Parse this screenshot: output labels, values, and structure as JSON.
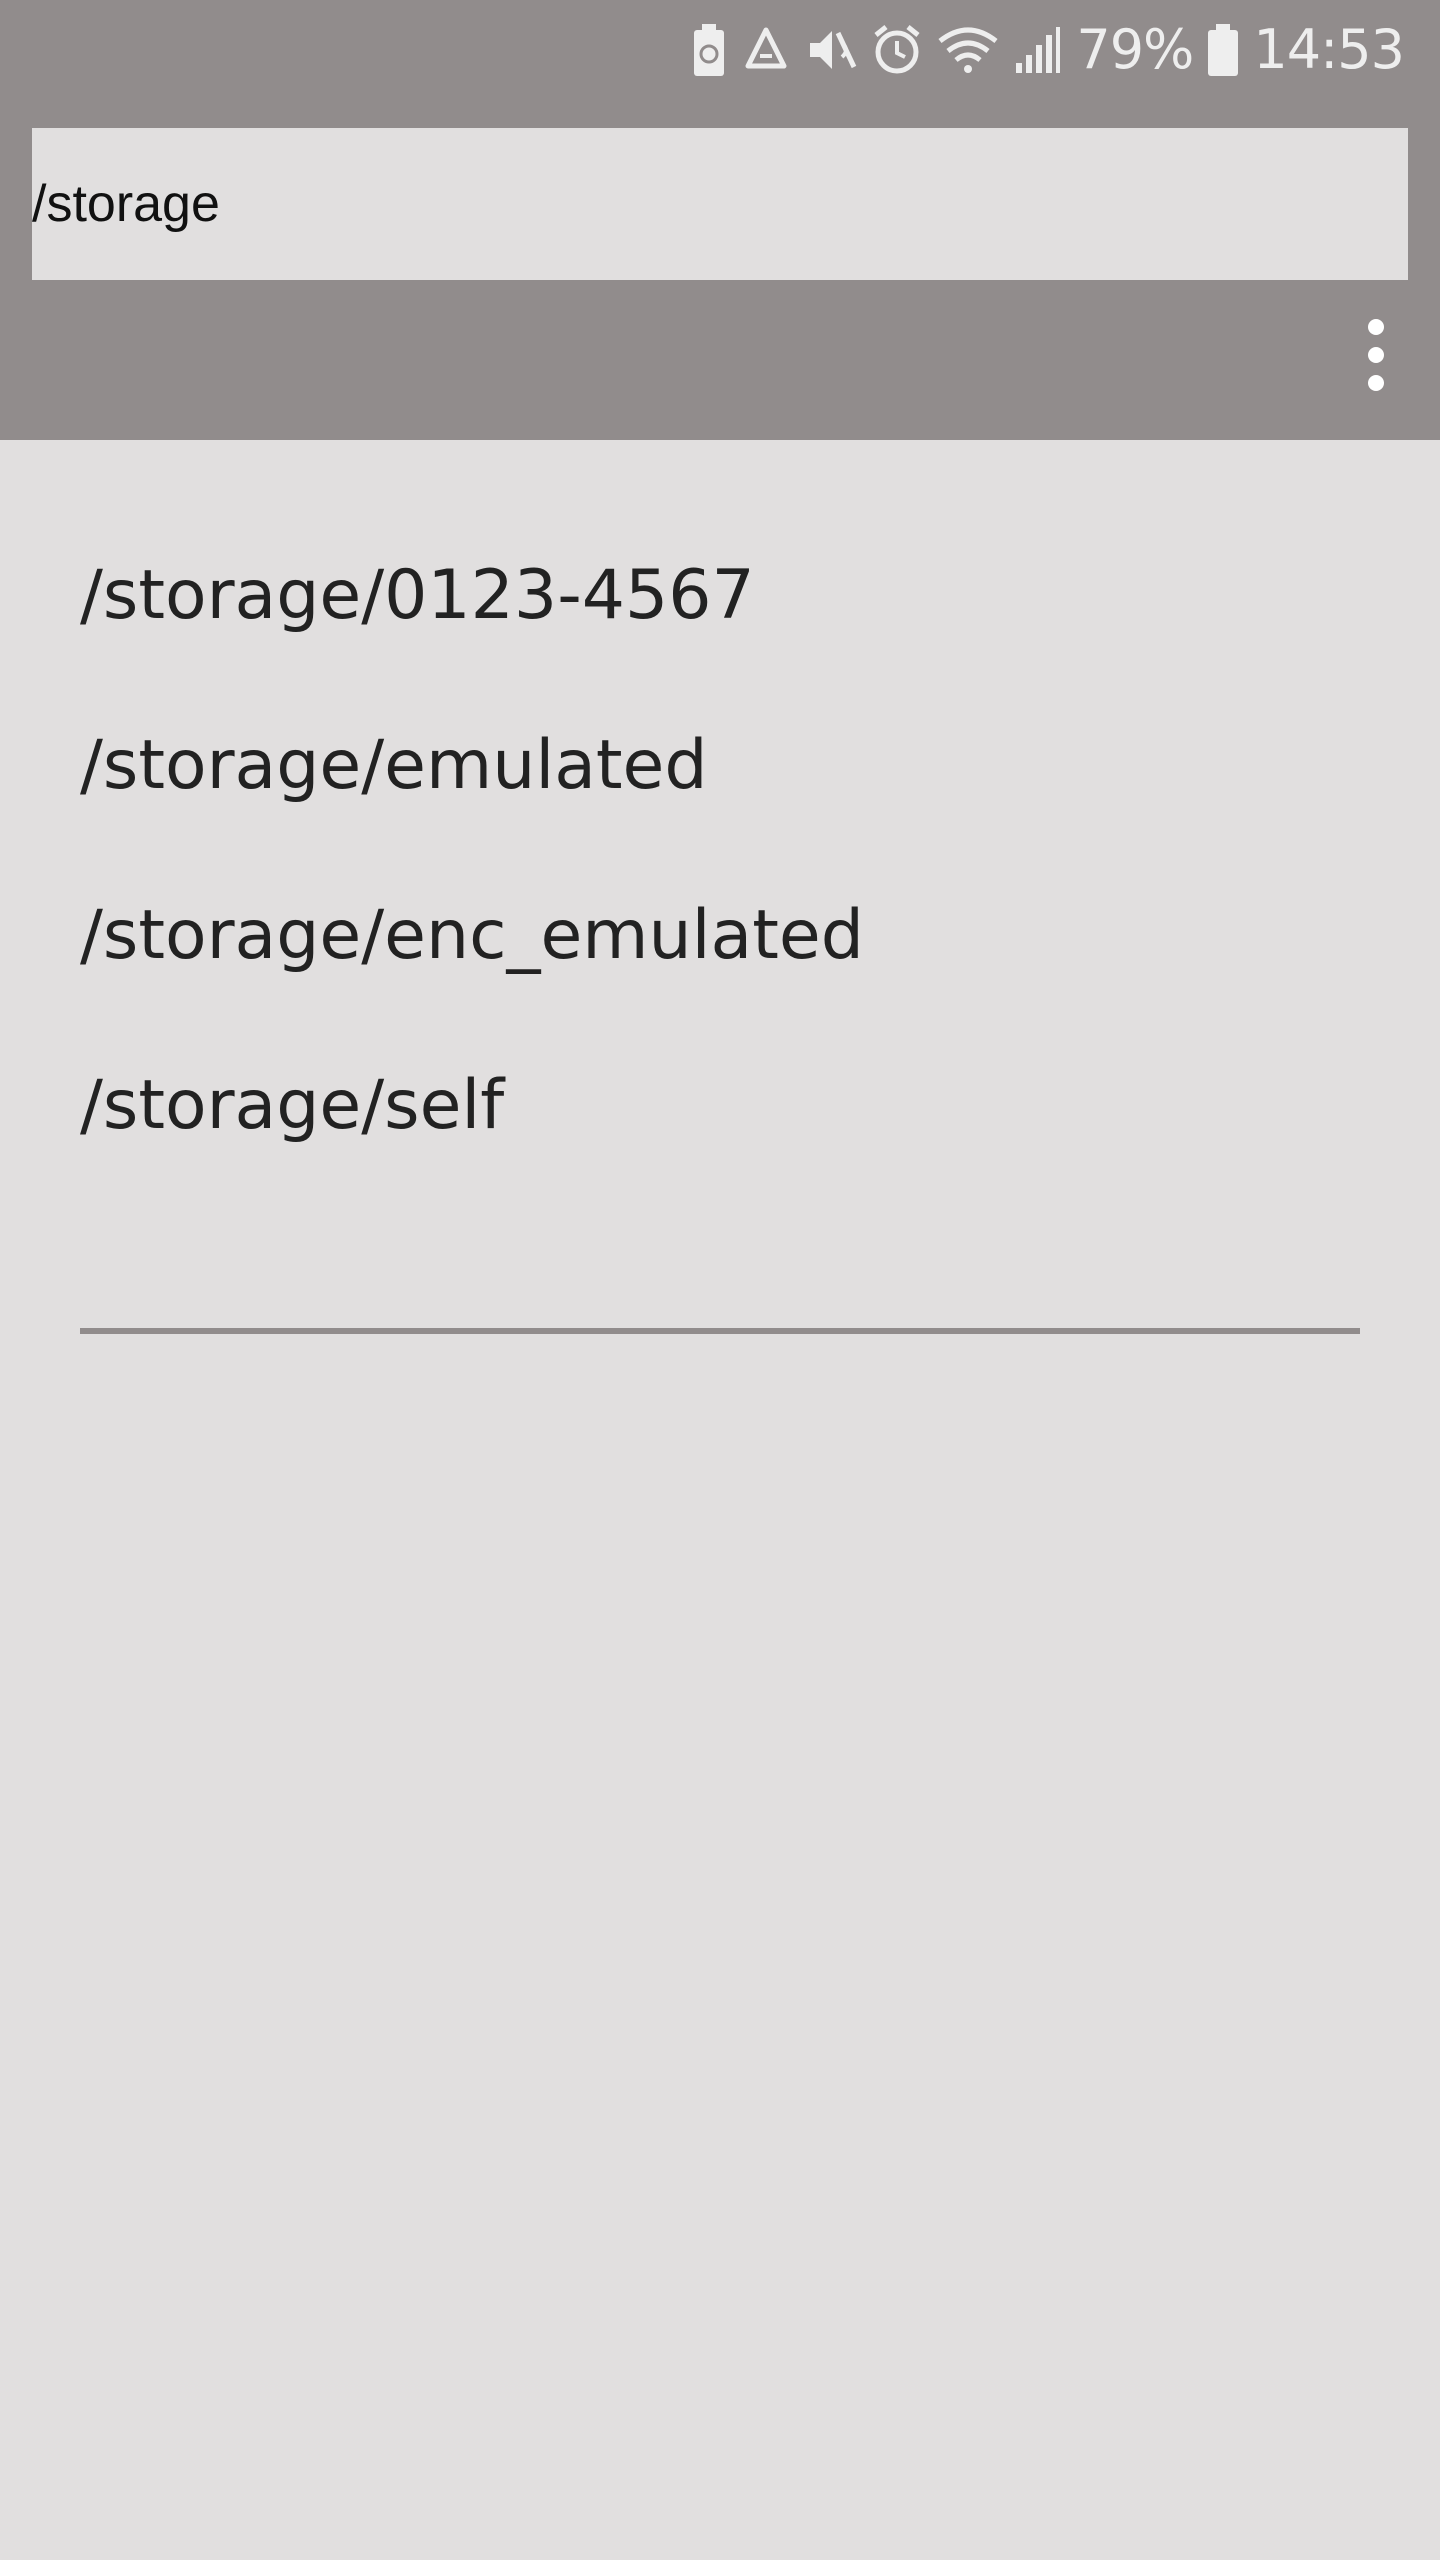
{
  "status_bar": {
    "battery_percent": "79%",
    "time": "14:53",
    "icons": [
      "battery-saver-icon",
      "recycle-icon",
      "mute-icon",
      "alarm-icon",
      "wifi-icon",
      "signal-icon",
      "battery-icon"
    ]
  },
  "path_bar": {
    "current_path": "/storage"
  },
  "directories": [
    {
      "label": "/storage/0123-4567"
    },
    {
      "label": "/storage/emulated"
    },
    {
      "label": "/storage/enc_emulated"
    },
    {
      "label": "/storage/self"
    }
  ],
  "colors": {
    "bar": "#918c8c",
    "background": "#e1dfdf",
    "text": "#222222"
  }
}
